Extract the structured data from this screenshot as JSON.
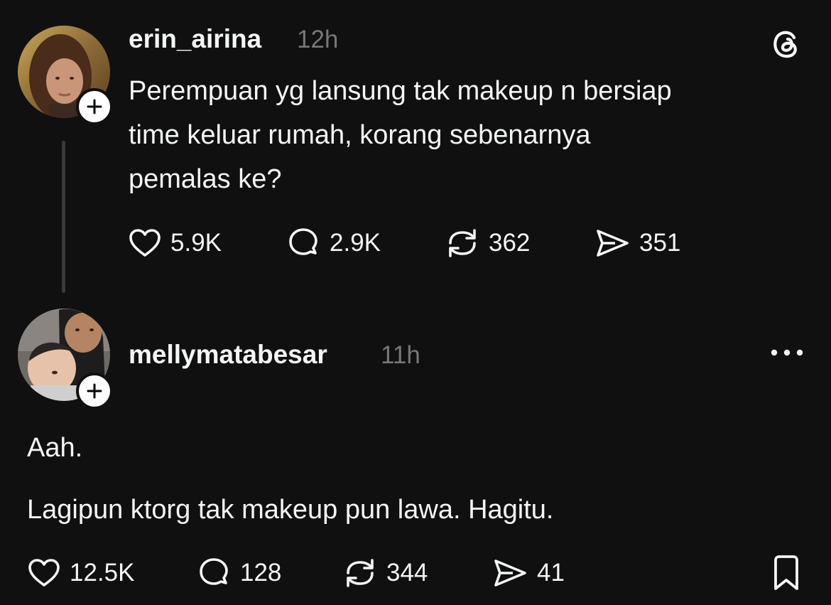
{
  "colors": {
    "background": "#101010",
    "text": "#f3f5f7",
    "muted": "#777777",
    "thread_line": "#3a3a3a"
  },
  "post": {
    "username": "erin_airina",
    "time": "12h",
    "text": "Perempuan yg lansung tak makeup n bersiap\ntime keluar rumah, korang sebenarnya\npemalas ke?",
    "likes": "5.9K",
    "replies": "2.9K",
    "reposts": "362",
    "shares": "351",
    "brand_icon": "threads-logo-icon",
    "follow_icon": "plus-icon"
  },
  "reply": {
    "username": "mellymatabesar",
    "time": "11h",
    "paragraph_1": "Aah.",
    "paragraph_2": "Lagipun ktorg tak makeup pun lawa. Hagitu.",
    "likes": "12.5K",
    "replies": "128",
    "reposts": "344",
    "shares": "41",
    "more_icon": "more-horizontal-icon",
    "bookmark_icon": "bookmark-icon",
    "follow_icon": "plus-icon"
  }
}
